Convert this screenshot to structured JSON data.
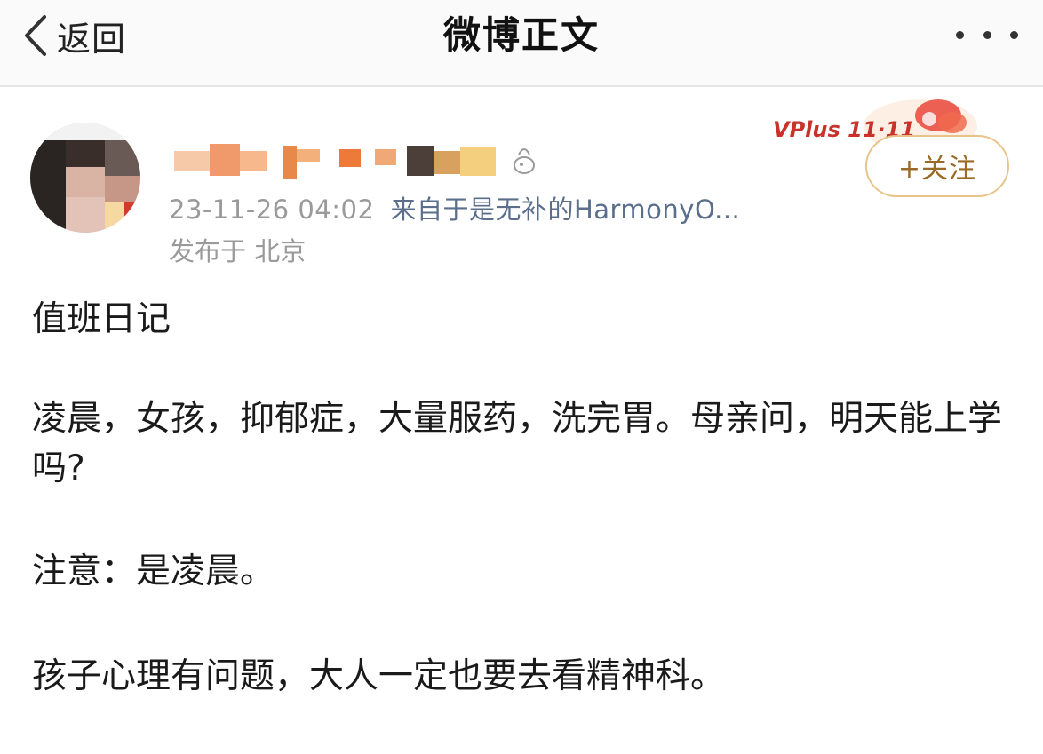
{
  "nav": {
    "back_label": "返回",
    "title": "微博正文"
  },
  "post": {
    "timestamp": "23-11-26 04:02",
    "source": "来自于是无补的HarmonyO...",
    "location": "发布于 北京",
    "follow_label": "+关注",
    "badge_text": "VPlus 11·11",
    "paragraphs": [
      "值班日记",
      "凌晨，女孩，抑郁症，大量服药，洗完胃。母亲问，明天能上学吗?",
      "注意：是凌晨。",
      "孩子心理有问题，大人一定也要去看精神科。"
    ]
  },
  "colors": {
    "nav_bg": "#fafafa",
    "meta_gray": "#9a9a9a",
    "source_blue": "#5b6f8c",
    "follow_border": "#e8c48a",
    "follow_text": "#9b6a27"
  }
}
